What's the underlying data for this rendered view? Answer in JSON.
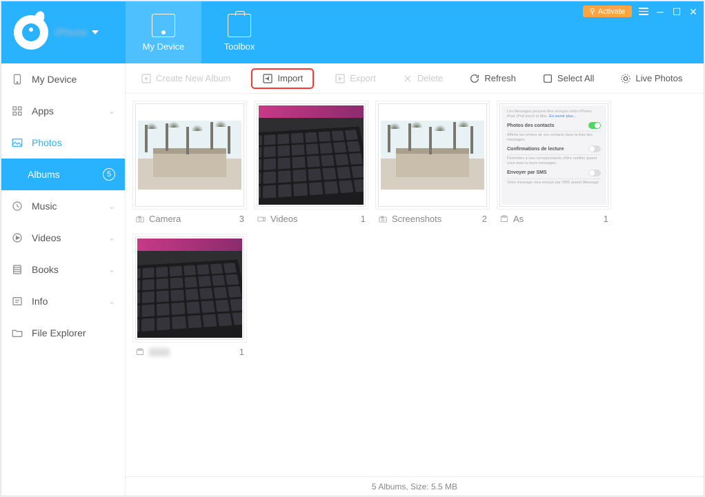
{
  "header": {
    "activate_label": "Activate",
    "tabs": [
      {
        "label": "My Device"
      },
      {
        "label": "Toolbox"
      }
    ]
  },
  "sidebar": {
    "items": [
      {
        "label": "My Device"
      },
      {
        "label": "Apps"
      },
      {
        "label": "Photos"
      },
      {
        "label": "Albums",
        "badge": "5"
      },
      {
        "label": "Music"
      },
      {
        "label": "Videos"
      },
      {
        "label": "Books"
      },
      {
        "label": "Info"
      },
      {
        "label": "File Explorer"
      }
    ]
  },
  "toolbar": {
    "create_album": "Create New Album",
    "import": "Import",
    "export": "Export",
    "delete": "Delete",
    "refresh": "Refresh",
    "select_all": "Select All",
    "live_photos": "Live Photos"
  },
  "albums": [
    {
      "name": "Camera",
      "count": "3",
      "type": "camera",
      "thumb": "building"
    },
    {
      "name": "Videos",
      "count": "1",
      "type": "video",
      "thumb": "keyboard"
    },
    {
      "name": "Screenshots",
      "count": "2",
      "type": "camera",
      "thumb": "building"
    },
    {
      "name": "As",
      "count": "1",
      "type": "generic",
      "thumb": "settings"
    },
    {
      "name": "",
      "count": "1",
      "type": "generic",
      "thumb": "keyboard"
    }
  ],
  "settings_thumb": {
    "intro": "Les Messages peuvent être envoyés entre iPhone, iPad, iPod touch et Mac.",
    "intro_link": "En savoir plus...",
    "r1_title": "Photos des contacts",
    "r1_sub": "Affiche les photos de vos contacts dans la liste des messages.",
    "r2_title": "Confirmations de lecture",
    "r2_sub": "Permettez à vos correspondants d'être notifiés quand vous avez lu leurs messages.",
    "r3_title": "Envoyer par SMS",
    "r3_sub": "Votre message sera envoyé par SMS quand iMessage"
  },
  "statusbar": {
    "text": "5 Albums, Size: 5.5 MB"
  }
}
